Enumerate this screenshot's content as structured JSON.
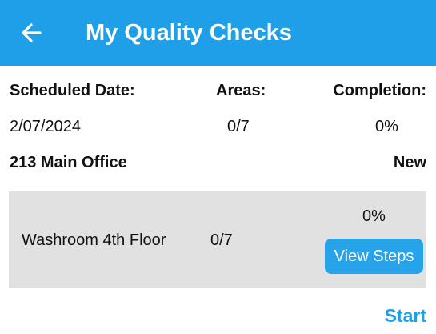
{
  "header": {
    "title": "My Quality Checks",
    "back_icon": "arrow-left-icon",
    "background_color": "#1f9fe8"
  },
  "summary": {
    "scheduled_date_label": "Scheduled Date:",
    "areas_label": "Areas:",
    "completion_label": "Completion:",
    "scheduled_date": "2/07/2024",
    "areas": "0/7",
    "completion": "0%"
  },
  "location": {
    "name": "213 Main Office",
    "status": "New"
  },
  "area_items": [
    {
      "name": "Washroom 4th Floor",
      "progress": "0/7",
      "completion": "0%",
      "button_label": "View Steps"
    }
  ],
  "footer": {
    "start_label": "Start",
    "accent_color": "#1f9fe8"
  }
}
